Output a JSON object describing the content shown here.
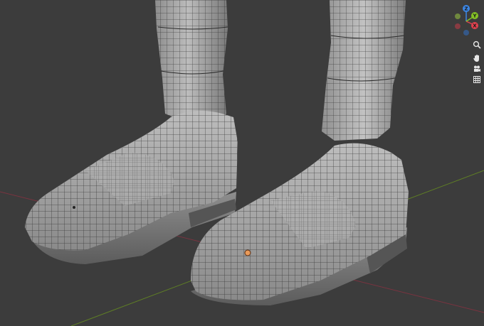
{
  "viewport": {
    "background": "#3c3c3c",
    "grid_x_axis_color": "#8a3a45",
    "grid_y_axis_color": "#6e8f2a",
    "mesh_color": "#a9a9a9",
    "wire_color": "#2b2b2b"
  },
  "gizmo": {
    "x_label": "X",
    "y_label": "Y",
    "z_label": "Z",
    "x_color": "#e0424f",
    "y_color": "#84c225",
    "z_color": "#3c87e6"
  },
  "nav_icons": [
    "zoom-icon",
    "hand-pan-icon",
    "camera-icon",
    "grid-view-icon"
  ]
}
